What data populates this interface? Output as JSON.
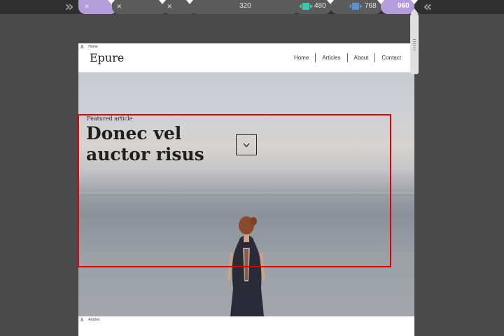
{
  "toolbar": {
    "collapse_left_icon": "double-chevron-right",
    "collapse_right_icon": "double-chevron-left",
    "breakpoints": [
      {
        "label": "",
        "close": "×",
        "state": "active"
      },
      {
        "label": "",
        "close": "×",
        "state": "closed"
      },
      {
        "label": "",
        "close": "×",
        "state": "closed"
      },
      {
        "label": "320",
        "state": "plain"
      },
      {
        "label": "480",
        "state": "plain",
        "swatch": "#3ec7b0"
      },
      {
        "label": "768",
        "state": "plain",
        "swatch": "#5b8fd6"
      },
      {
        "label": "960",
        "state": "current"
      }
    ]
  },
  "site": {
    "anchor_label": "Home",
    "logo": "Epure",
    "nav": [
      "Home",
      "Articles",
      "About",
      "Contact"
    ]
  },
  "hero": {
    "kicker": "Featured article",
    "title": "Donec vel auctor risus",
    "scroll_icon": "chevron-down-icon"
  },
  "next_section": {
    "anchor_label": "Articles"
  },
  "colors": {
    "toolbar_bg": "#2f2f2f",
    "active_breakpoint": "#b39ddb",
    "selection": "#e00000",
    "canvas_bg": "#4a4a4a"
  }
}
